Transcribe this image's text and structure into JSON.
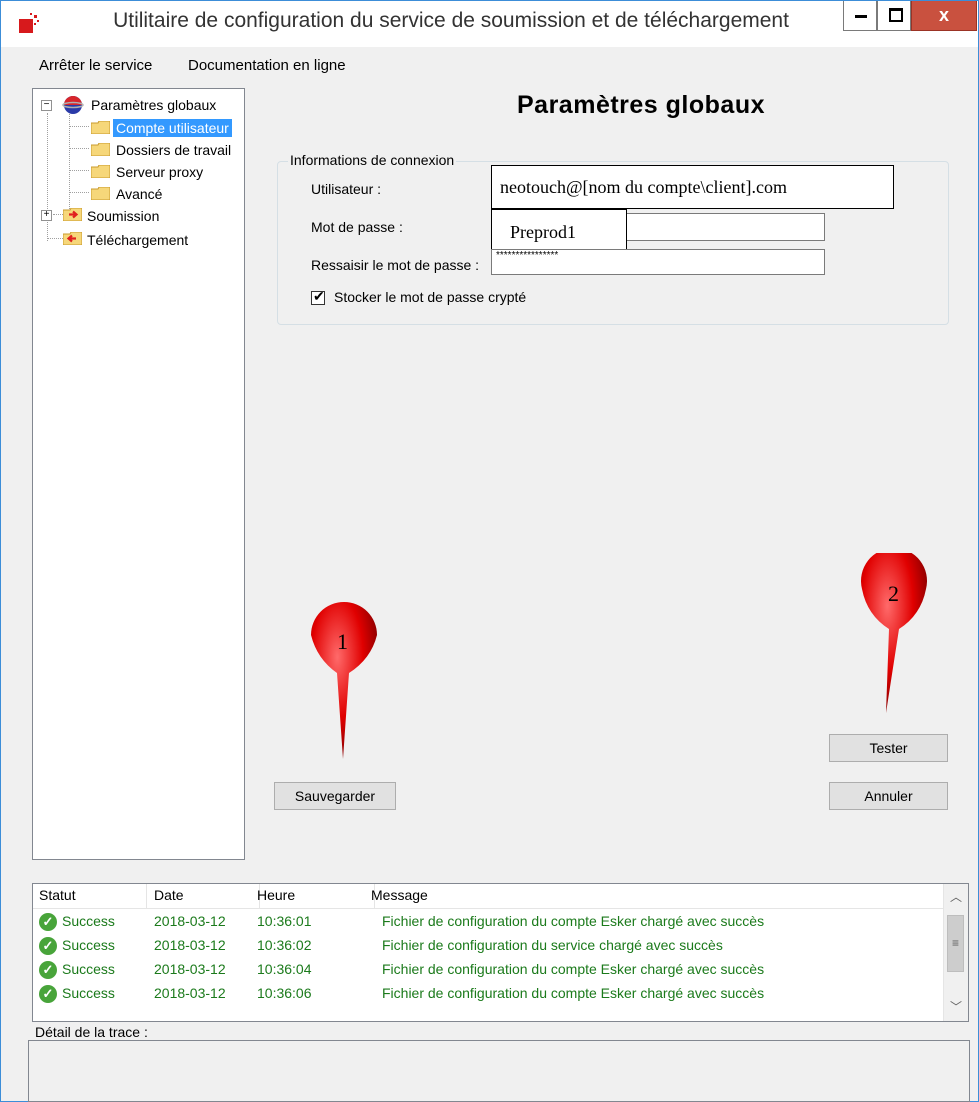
{
  "window": {
    "title": "Utilitaire de configuration du service de soumission et de téléchargement",
    "close_label": "x"
  },
  "menu": {
    "items": [
      "Arrêter le service",
      "Documentation en ligne"
    ]
  },
  "tree": {
    "items": [
      {
        "label": "Paramètres globaux",
        "icon": "globe-icon"
      },
      {
        "label": "Compte utilisateur",
        "icon": "folder-icon",
        "selected": true
      },
      {
        "label": "Dossiers de travail",
        "icon": "folder-icon"
      },
      {
        "label": "Serveur proxy",
        "icon": "folder-icon"
      },
      {
        "label": "Avancé",
        "icon": "folder-icon"
      },
      {
        "label": "Soumission",
        "icon": "folder-submit-icon"
      },
      {
        "label": "Téléchargement",
        "icon": "folder-download-icon"
      }
    ],
    "expander_minus": "−",
    "expander_plus": "+"
  },
  "main": {
    "title": "Paramètres globaux",
    "group_label": "Informations de connexion",
    "fields": {
      "user_label": "Utilisateur :",
      "user_value": "neotouch@[nom du compte\\client].com",
      "password_label": "Mot de passe :",
      "password_value": "Preprod1",
      "confirm_label": "Ressaisir le mot de passe :",
      "confirm_value": "****************"
    },
    "store_encrypted_label": "Stocker le mot de passe crypté",
    "store_encrypted_checked": true,
    "save_button": "Sauvegarder",
    "test_button": "Tester",
    "cancel_button": "Annuler"
  },
  "annotations": {
    "pin1": "1",
    "pin2": "2",
    "pin_color": "#e00000"
  },
  "log": {
    "columns": [
      "Statut",
      "Date",
      "Heure",
      "Message"
    ],
    "rows": [
      {
        "status": "Success",
        "date": "2018-03-12",
        "time": "10:36:01",
        "message": "Fichier de configuration du compte Esker chargé avec succès"
      },
      {
        "status": "Success",
        "date": "2018-03-12",
        "time": "10:36:02",
        "message": "Fichier de configuration du service chargé avec succès"
      },
      {
        "status": "Success",
        "date": "2018-03-12",
        "time": "10:36:04",
        "message": "Fichier de configuration du compte Esker chargé avec succès"
      },
      {
        "status": "Success",
        "date": "2018-03-12",
        "time": "10:36:06",
        "message": "Fichier de configuration du compte Esker chargé avec succès"
      }
    ],
    "status_color": "#1b7a1b"
  },
  "trace": {
    "label": "Détail de la trace :"
  }
}
